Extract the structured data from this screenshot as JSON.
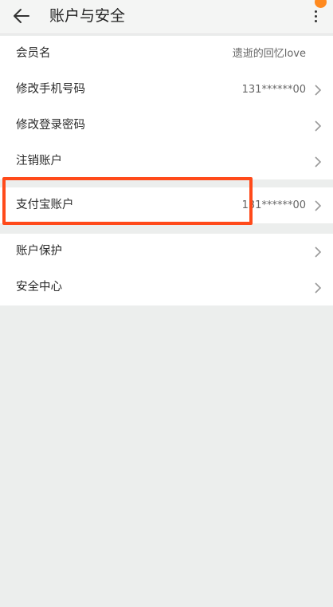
{
  "header": {
    "title": "账户与安全",
    "back_icon": "back-arrow-icon",
    "more_icon": "more-vertical-icon"
  },
  "groups": [
    {
      "items": [
        {
          "label": "会员名",
          "value": "遗逝的回忆love",
          "arrow": false
        },
        {
          "label": "修改手机号码",
          "value": "131******00",
          "arrow": true
        },
        {
          "label": "修改登录密码",
          "value": "",
          "arrow": true
        },
        {
          "label": "注销账户",
          "value": "",
          "arrow": true
        }
      ]
    },
    {
      "items": [
        {
          "label": "支付宝账户",
          "value": "131******00",
          "arrow": true
        }
      ]
    },
    {
      "items": [
        {
          "label": "账户保护",
          "value": "",
          "arrow": true
        },
        {
          "label": "安全中心",
          "value": "",
          "arrow": true
        }
      ]
    }
  ],
  "colors": {
    "highlight": "#ff4a1a",
    "notify_dot": "#ff8a1f",
    "background": "#eceeed"
  }
}
